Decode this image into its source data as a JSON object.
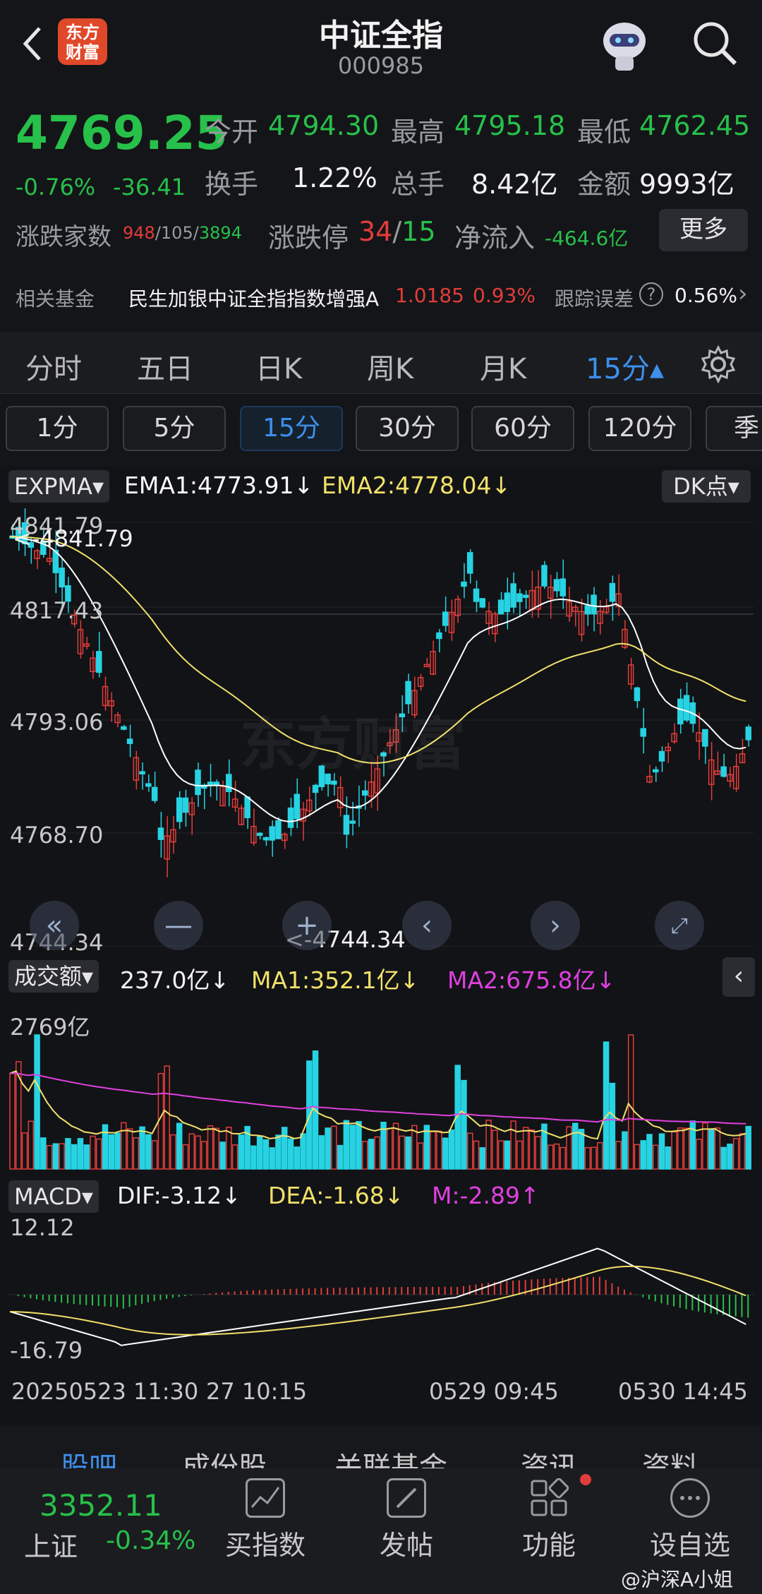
{
  "header": {
    "title": "中证全指",
    "code": "000985",
    "logo_text": "东方财富",
    "back_icon": "chevron-left-icon",
    "robot_icon": "robot-avatar-icon",
    "search_icon": "search-icon"
  },
  "quote": {
    "price": "4769.25",
    "change_pct": "-0.76%",
    "change_abs": "-36.41",
    "open_label": "今开",
    "open": "4794.30",
    "high_label": "最高",
    "high": "4795.18",
    "low_label": "最低",
    "low": "4762.45",
    "turnover_rate_label": "换手",
    "turnover_rate": "1.22%",
    "volume_label": "总手",
    "volume": "8.42亿",
    "amount_label": "金额",
    "amount": "9993亿",
    "breadth_label": "涨跌家数",
    "breadth_up": "948",
    "breadth_sep1": "/",
    "breadth_flat": "105",
    "breadth_sep2": "/",
    "breadth_down": "3894",
    "limit_label": "涨跌停",
    "limit_up": "34",
    "limit_sep": "/",
    "limit_down": "15",
    "inflow_label": "净流入",
    "inflow": "-464.6亿",
    "more_button": "更多",
    "fund_label": "相关基金",
    "fund_name": "民生加银中证全指指数增强A",
    "fund_nav": "1.0185",
    "fund_change": "0.93%",
    "tracking_label": "跟踪误差",
    "tracking_value": "0.56%",
    "tracking_arrow": "›"
  },
  "period_tabs": [
    "分时",
    "五日",
    "日K",
    "周K",
    "月K",
    "15分▴"
  ],
  "minute_chips": [
    "1分",
    "5分",
    "15分",
    "30分",
    "60分",
    "120分",
    "季"
  ],
  "kline_panel": {
    "indicator": "EXPMA▾",
    "ema1": "EMA1:4773.91↓",
    "ema2": "EMA2:4778.04↓",
    "dk_button": "DK点▾",
    "y_labels": [
      "4841.79",
      "4817.43",
      "4793.06",
      "4768.70",
      "4744.34"
    ],
    "high_marker": "<-4841.79",
    "low_marker": "<-4744.34",
    "watermark": "东方财富"
  },
  "volume_panel": {
    "indicator": "成交额▾",
    "value": "237.0亿↓",
    "ma1": "MA1:352.1亿↓",
    "ma2": "MA2:675.8亿↓",
    "max_label": "2769亿"
  },
  "macd_panel": {
    "indicator": "MACD▾",
    "dif": "DIF:-3.12↓",
    "dea": "DEA:-1.68↓",
    "m": "M:-2.89↑",
    "top_label": "12.12",
    "bottom_label": "-16.79"
  },
  "time_axis": [
    "20250523 11:30",
    "27 10:15",
    "0529 09:45",
    "0530 14:45"
  ],
  "bottom_tabs": [
    "股吧",
    "成份股",
    "关联基金",
    "资讯",
    "资料"
  ],
  "bottom_bar": {
    "sh_price": "3352.11",
    "sh_label": "上证",
    "sh_change": "-0.34%",
    "items": [
      "买指数",
      "发帖",
      "功能",
      "设自选"
    ]
  },
  "weibo_mark": "@沪深A小姐",
  "colors": {
    "up": "#e23d3a",
    "down": "#27c04b",
    "accent": "#3d8fea",
    "bar_down": "#27d3e3",
    "ema1": "#ffffff",
    "ema2": "#f0e06a",
    "ma2": "#e040e0"
  }
}
